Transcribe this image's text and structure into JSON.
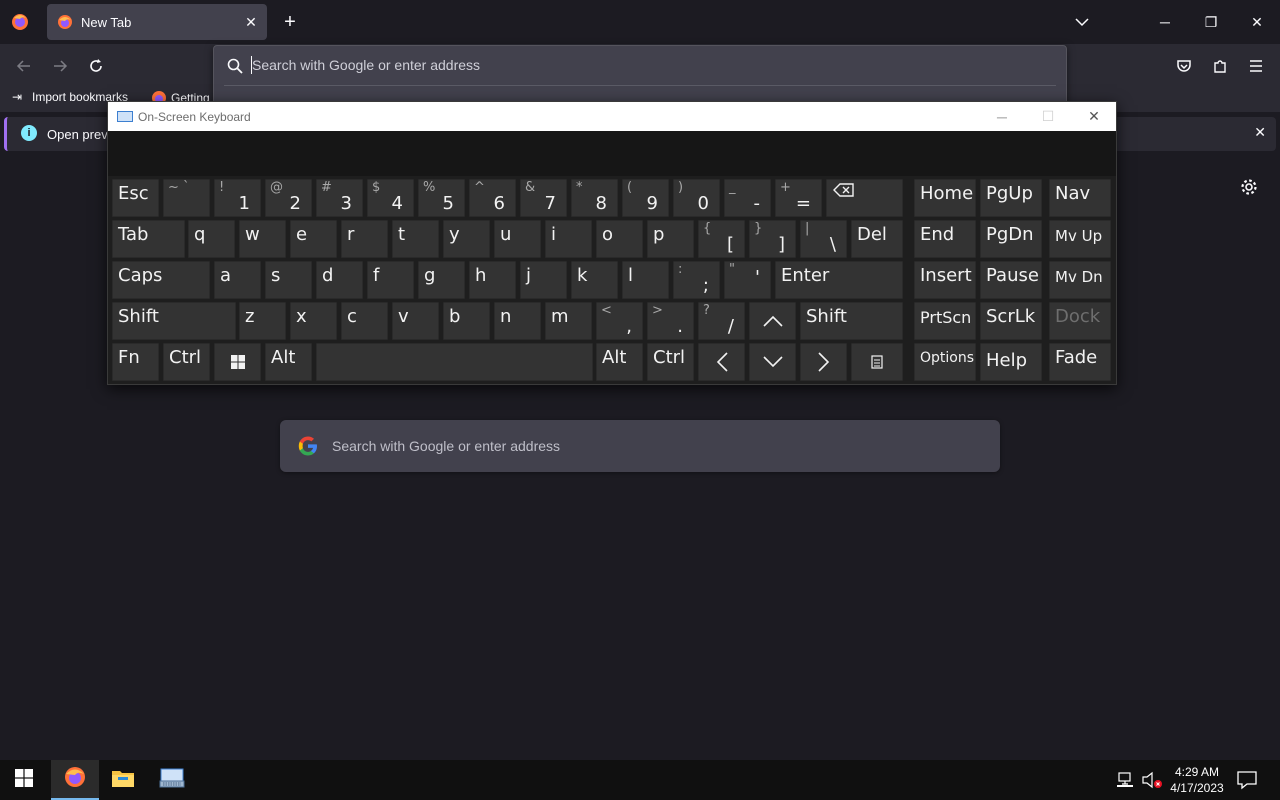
{
  "browser": {
    "tab": {
      "title": "New Tab"
    },
    "urlbar": {
      "placeholder": "Search with Google or enter address"
    },
    "bookmarks": [
      {
        "label": "Import bookmarks"
      },
      {
        "label": "Getting"
      }
    ],
    "notification": {
      "text": "Open previo"
    }
  },
  "newtab": {
    "search_placeholder": "Search with Google or enter address"
  },
  "osk": {
    "title": "On-Screen Keyboard",
    "keys": {
      "esc": "Esc",
      "backtick_sym": "~ `",
      "k1_sym": "!",
      "k1": "1",
      "k2_sym": "@",
      "k2": "2",
      "k3_sym": "#",
      "k3": "3",
      "k4_sym": "$",
      "k4": "4",
      "k5_sym": "%",
      "k5": "5",
      "k6_sym": "^",
      "k6": "6",
      "k7_sym": "&",
      "k7": "7",
      "k8_sym": "*",
      "k8": "8",
      "k9_sym": "(",
      "k9": "9",
      "k0_sym": ")",
      "k0": "0",
      "minus_sym": "_",
      "minus": "-",
      "eq_sym": "+",
      "eq": "=",
      "home": "Home",
      "pgup": "PgUp",
      "nav": "Nav",
      "tab": "Tab",
      "q": "q",
      "w": "w",
      "e": "e",
      "r": "r",
      "t": "t",
      "y": "y",
      "u": "u",
      "i": "i",
      "o": "o",
      "p": "p",
      "lbr_sym": "{",
      "lbr": "[",
      "rbr_sym": "}",
      "rbr": "]",
      "bslash_sym": "|",
      "bslash": "\\",
      "del": "Del",
      "end": "End",
      "pgdn": "PgDn",
      "mvup": "Mv Up",
      "caps": "Caps",
      "a": "a",
      "s": "s",
      "d": "d",
      "f": "f",
      "g": "g",
      "h": "h",
      "j": "j",
      "k": "k",
      "l": "l",
      "semi_sym": ":",
      "semi": ";",
      "quote_sym": "\"",
      "quote": "'",
      "enter": "Enter",
      "insert": "Insert",
      "pause": "Pause",
      "mvdn": "Mv Dn",
      "shift": "Shift",
      "z": "z",
      "x": "x",
      "c": "c",
      "v": "v",
      "b": "b",
      "n": "n",
      "m": "m",
      "comma_sym": "<",
      "comma": ",",
      "period_sym": ">",
      "period": ".",
      "slash_sym": "?",
      "slash": "/",
      "up": "^",
      "rshift": "Shift",
      "prtscn": "PrtScn",
      "scrlk": "ScrLk",
      "dock": "Dock",
      "fn": "Fn",
      "ctrl": "Ctrl",
      "alt": "Alt",
      "ralt": "Alt",
      "rctrl": "Ctrl",
      "left": "<",
      "down": "v",
      "right": ">",
      "options": "Options",
      "help": "Help",
      "fade": "Fade"
    }
  },
  "taskbar": {
    "time": "4:29 AM",
    "date": "4/17/2023"
  },
  "colors": {
    "accent": "#76b9ed",
    "notification_border": "#a070f0",
    "info_icon": "#80ebff"
  }
}
